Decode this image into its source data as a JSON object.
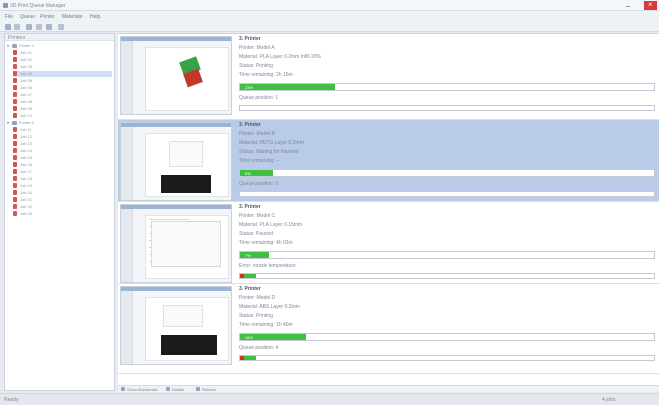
{
  "window": {
    "title": "3D Print Queue Manager",
    "accent": "#40c040",
    "close_color": "#d83a3a"
  },
  "menu": [
    "File",
    "Queue",
    "Printer",
    "Materials",
    "Help"
  ],
  "sidebar": {
    "header": "Printers",
    "groups": [
      {
        "label": "Printer 1",
        "items": [
          "Job 01",
          "Job 02",
          "Job 03",
          "Job 04",
          "Job 05",
          "Job 06",
          "Job 07",
          "Job 08",
          "Job 09",
          "Job 10"
        ]
      },
      {
        "label": "Printer 2",
        "items": [
          "Job 11",
          "Job 12",
          "Job 13",
          "Job 14",
          "Job 15",
          "Job 16",
          "Job 17",
          "Job 18",
          "Job 19",
          "Job 20",
          "Job 21",
          "Job 22",
          "Job 23"
        ]
      }
    ]
  },
  "jobs": [
    {
      "name": "3. Printer",
      "lines": [
        "Printer: Model A",
        "Material: PLA  Layer 0.2mm  Infill 20%",
        "Status: Printing",
        "Time remaining: 2h 15m"
      ],
      "progress": 0.23,
      "progress_label": "23%",
      "queue_label": "Queue position: 1"
    },
    {
      "name": "3. Printer",
      "lines": [
        "Printer: Model B",
        "Material: PETG  Layer 0.2mm",
        "Status: Waiting for filament",
        "Time remaining: --"
      ],
      "progress": 0.08,
      "progress_label": "8%",
      "queue_label": "Queue position: 2"
    },
    {
      "name": "3. Printer",
      "lines": [
        "Printer: Model C",
        "Material: PLA  Layer 0.15mm",
        "Status: Paused",
        "Time remaining: 4h 02m"
      ],
      "progress": 0.07,
      "progress_label": "7%",
      "queue_label": "Error: nozzle temperature",
      "queue_flag": true
    },
    {
      "name": "3. Printer",
      "lines": [
        "Printer: Model D",
        "Material: ABS  Layer 0.2mm",
        "Status: Printing",
        "Time remaining: 1h 40m"
      ],
      "progress": 0.16,
      "progress_label": "16%",
      "queue_label": "Queue position: 4",
      "queue_flag": true
    }
  ],
  "bottombar": [
    "Show thumbnails",
    "Details",
    "Refresh"
  ],
  "status": {
    "left": "Ready",
    "right": "4 jobs"
  }
}
